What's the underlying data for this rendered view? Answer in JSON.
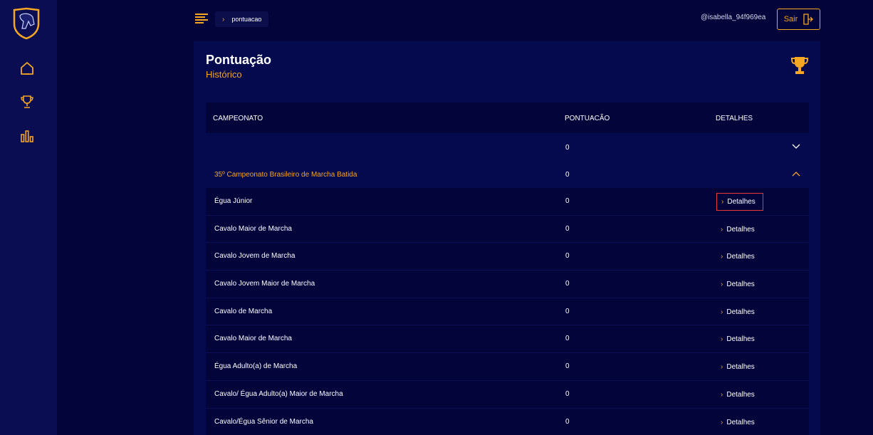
{
  "sidebar": {
    "logo": "horse-logo",
    "items": [
      {
        "icon": "home-icon"
      },
      {
        "icon": "trophy-icon"
      },
      {
        "icon": "bar-chart-icon"
      }
    ]
  },
  "topbar": {
    "breadcrumb": "pontuacao",
    "username": "@isabella_94f969ea",
    "logout_label": "Sair"
  },
  "page": {
    "title": "Pontuação",
    "subtitle": "Histórico"
  },
  "table": {
    "headers": [
      "CAMPEONATO",
      "PONTUACÃO",
      "DETALHES"
    ],
    "groups": [
      {
        "name": "",
        "points": "0",
        "expanded": false
      },
      {
        "name": "35º Campeonato Brasileiro de Marcha Batida",
        "points": "0",
        "expanded": true
      }
    ],
    "detail_label": "Detalhes",
    "rows": [
      {
        "name": "Égua Júnior",
        "points": "0"
      },
      {
        "name": "Cavalo Maior de Marcha",
        "points": "0"
      },
      {
        "name": "Cavalo Jovem de Marcha",
        "points": "0"
      },
      {
        "name": "Cavalo Jovem Maior de Marcha",
        "points": "0"
      },
      {
        "name": "Cavalo de Marcha",
        "points": "0"
      },
      {
        "name": "Cavalo Maior de Marcha",
        "points": "0"
      },
      {
        "name": "Égua Adulto(a) de Marcha",
        "points": "0"
      },
      {
        "name": "Cavalo/ Égua Adulto(a) Maior de Marcha",
        "points": "0"
      },
      {
        "name": "Cavalo/Égua Sênior de Marcha",
        "points": "0"
      }
    ]
  },
  "colors": {
    "accent": "#f5a623",
    "background": "#02043a",
    "card": "#050a4e",
    "sidebar": "#0a0d52",
    "focus": "#e53935"
  }
}
